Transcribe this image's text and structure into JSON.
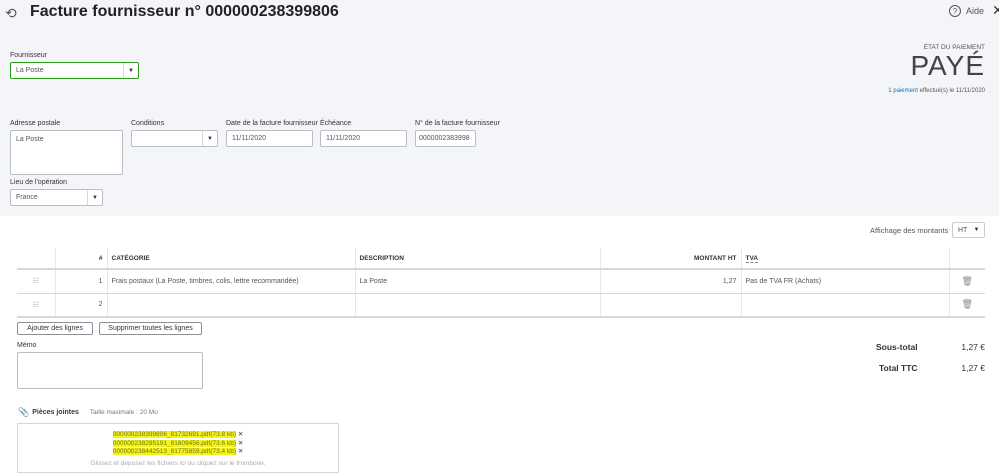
{
  "header": {
    "title": "Facture fournisseur n° 000000238399806",
    "help_label": "Aide"
  },
  "payment": {
    "status_label": "ÉTAT DU PAIEMENT",
    "status": "PAYÉ",
    "count": "1",
    "link": "paiement",
    "suffix": "effectué(s) le 11/11/2020"
  },
  "form": {
    "supplier_label": "Fournisseur",
    "supplier": "La Poste",
    "address_label": "Adresse postale",
    "address": "La Poste",
    "terms_label": "Conditions",
    "terms": "",
    "date_label": "Date de la facture fournisseur",
    "date": "11/11/2020",
    "due_label": "Échéance",
    "due": "11/11/2020",
    "number_label": "N° de la facture fournisseur",
    "number": "0000002383998",
    "place_label": "Lieu de l'opération",
    "place": "France"
  },
  "amounts": {
    "label": "Affichage des montants",
    "value": "HT"
  },
  "table": {
    "headers": [
      "#",
      "CATÉGORIE",
      "DESCRIPTION",
      "MONTANT HT",
      "TVA"
    ],
    "rows": [
      {
        "n": "1",
        "category": "Frais postaux (La Poste, timbres, colis, lettre recommandée)",
        "description": "La Poste",
        "amount": "1,27",
        "tva": "Pas de TVA FR (Achats)"
      },
      {
        "n": "2",
        "category": "",
        "description": "",
        "amount": "",
        "tva": ""
      }
    ]
  },
  "buttons": {
    "add": "Ajouter des lignes",
    "clear": "Supprimer toutes les lignes"
  },
  "memo": {
    "label": "Mémo",
    "value": ""
  },
  "totals": {
    "subtotal_label": "Sous-total",
    "subtotal": "1,27 €",
    "total_label": "Total TTC",
    "total": "1,27 €"
  },
  "attachments": {
    "label": "Pièces jointes",
    "max": "Taille maximale : 20 Mo",
    "files": [
      {
        "name": "000000238399806_81732691.pdf",
        "size": "(73.8 kb)"
      },
      {
        "name": "000000238295191_81609456.pdf",
        "size": "(73.6 kb)"
      },
      {
        "name": "000000238442513_81775859.pdf",
        "size": "(73.4 kb)"
      }
    ],
    "hint": "Glissez et déposez les fichiers ici ou cliquez sur le trombone."
  }
}
